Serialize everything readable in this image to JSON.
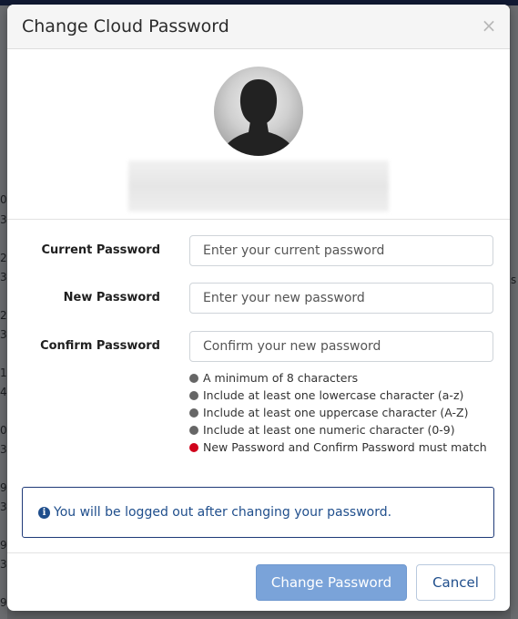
{
  "modal": {
    "title": "Change Cloud Password",
    "close_glyph": "×"
  },
  "form": {
    "current": {
      "label": "Current Password",
      "placeholder": "Enter your current password",
      "value": ""
    },
    "new": {
      "label": "New Password",
      "placeholder": "Enter your new password",
      "value": ""
    },
    "confirm": {
      "label": "Confirm Password",
      "placeholder": "Confirm your new password",
      "value": ""
    }
  },
  "rules": [
    {
      "text": "A minimum of 8 characters",
      "status_color": "#666666"
    },
    {
      "text": "Include at least one lowercase character (a-z)",
      "status_color": "#666666"
    },
    {
      "text": "Include at least one uppercase character (A-Z)",
      "status_color": "#666666"
    },
    {
      "text": "Include at least one numeric character (0-9)",
      "status_color": "#666666"
    },
    {
      "text": "New Password and Confirm Password must match",
      "status_color": "#d0021b"
    }
  ],
  "info": {
    "icon": "info-icon",
    "glyph": "i",
    "text": "You will be logged out after changing your password."
  },
  "buttons": {
    "submit": "Change Password",
    "cancel": "Cancel"
  },
  "background": {
    "left_digits": [
      "0",
      "3",
      "2",
      "3",
      "2",
      "3",
      "1",
      "4",
      "0",
      "3",
      "9",
      "3",
      "9",
      "3",
      "9"
    ],
    "right_fragment": "s"
  },
  "colors": {
    "accent": "#1f4e8c",
    "primary_button": "#7aa3d9",
    "rule_unmet": "#666666",
    "rule_error": "#d0021b"
  }
}
